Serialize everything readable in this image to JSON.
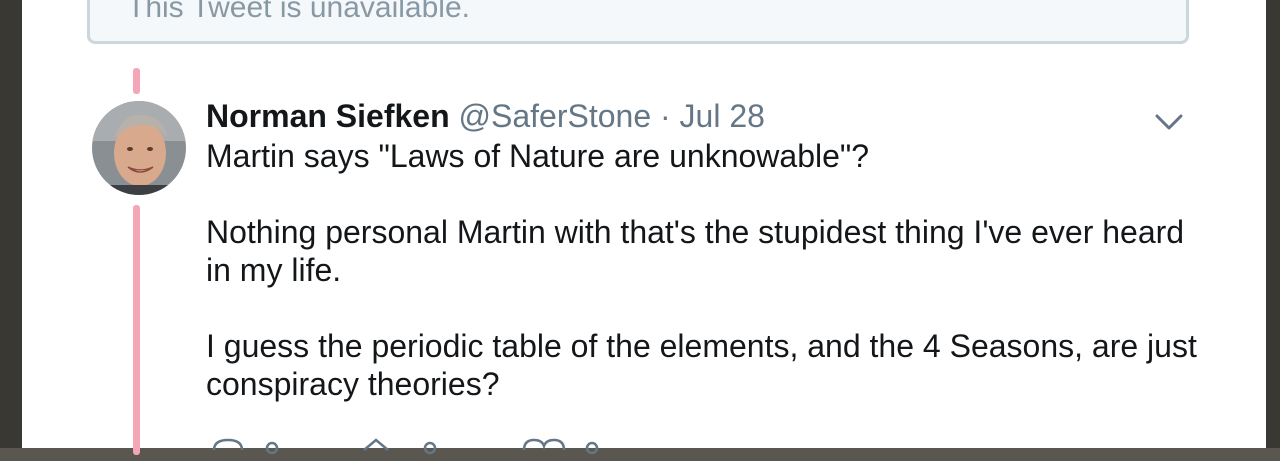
{
  "unavailable": {
    "text": "This Tweet is unavailable."
  },
  "tweet": {
    "author_name": "Norman Siefken",
    "handle": "@SaferStone",
    "separator": "·",
    "date": "Jul 28",
    "paragraphs": [
      "Martin says \"Laws of Nature are unknowable\"?",
      "Nothing personal Martin with that's the stupidest thing I've ever heard in my life.",
      "I guess the periodic table of the elements, and the 4 Seasons, are just conspiracy theories?"
    ]
  },
  "icons": {
    "more": "chevron-down-icon",
    "reply": "reply-icon",
    "retweet": "retweet-icon",
    "like": "heart-icon"
  },
  "colors": {
    "thread_line": "#f4a6b6",
    "meta_text": "#657786",
    "body_text": "#14171a",
    "box_border": "#ccd6dd"
  }
}
